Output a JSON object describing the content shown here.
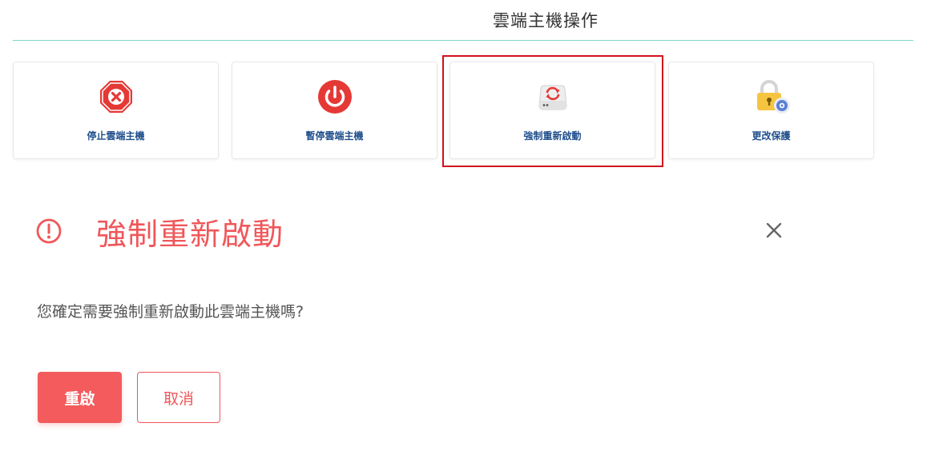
{
  "section": {
    "title": "雲端主機操作"
  },
  "actions": [
    {
      "label": "停止雲端主機",
      "icon": "stop-octagon-icon",
      "color": "#e53935"
    },
    {
      "label": "暫停雲端主機",
      "icon": "power-icon",
      "color": "#e53935"
    },
    {
      "label": "強制重新啟動",
      "icon": "server-restart-icon",
      "color": "#e53935",
      "selected": true
    },
    {
      "label": "更改保護",
      "icon": "lock-gear-icon",
      "color": "#f5c542"
    }
  ],
  "dialog": {
    "title": "強制重新啟動",
    "message": "您確定需要強制重新啟動此雲端主機嗎?",
    "confirm_label": "重啟",
    "cancel_label": "取消",
    "accent_color": "#f0575a"
  },
  "colors": {
    "divider": "#7fd9c7",
    "card_label": "#1f4e8c",
    "selected_outline": "#d0121b",
    "primary_button": "#f35b5d"
  }
}
